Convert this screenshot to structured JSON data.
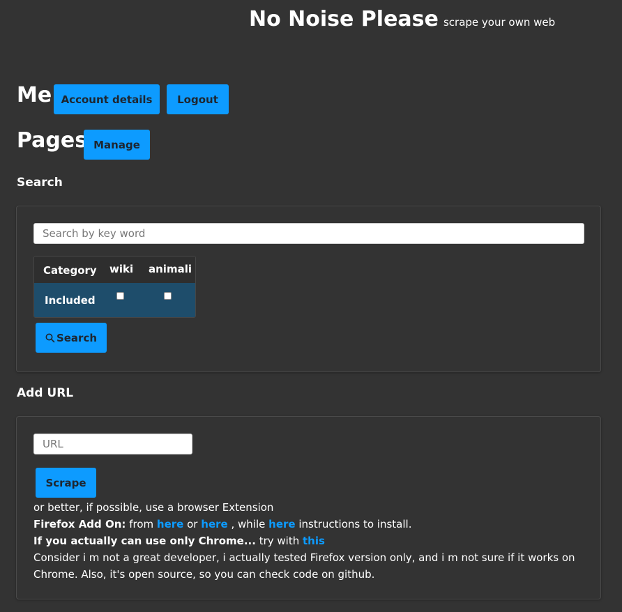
{
  "header": {
    "title": "No Noise Please",
    "subtitle": "scrape your own web"
  },
  "me": {
    "heading": "Me",
    "account_button": "Account details",
    "logout_button": "Logout"
  },
  "pages": {
    "heading": "Pages",
    "manage_button": "Manage"
  },
  "search": {
    "heading": "Search",
    "placeholder": "Search by key word",
    "value": "",
    "table": {
      "columns": [
        "Category",
        "wiki",
        "animali"
      ],
      "row_label": "Included",
      "checked": [
        false,
        false
      ]
    },
    "button_label": "Search",
    "button_icon": "search-icon"
  },
  "add_url": {
    "heading": "Add URL",
    "placeholder": "URL",
    "value": "",
    "scrape_button": "Scrape",
    "extension_note": "or better, if possible, use a browser Extension",
    "firefox_label": "Firefox Add On:",
    "from_text": "from",
    "link_here_1": "here",
    "or_text": "or",
    "link_here_2": "here",
    "while_text": ", while",
    "link_here_3": "here",
    "instructions_text": "instructions to install.",
    "chrome_label": "If you actually can use only Chrome...",
    "try_text": "try with",
    "link_this": "this",
    "disclaimer_line1": "Consider i m not a great developer, i actually tested Firefox version only, and i m not sure if it works on",
    "disclaimer_line2": "Chrome. Also, it's open source, so you can check code on github."
  },
  "colors": {
    "background": "#333333",
    "accent": "#0d9bff",
    "table_row": "#1e4d6b"
  }
}
